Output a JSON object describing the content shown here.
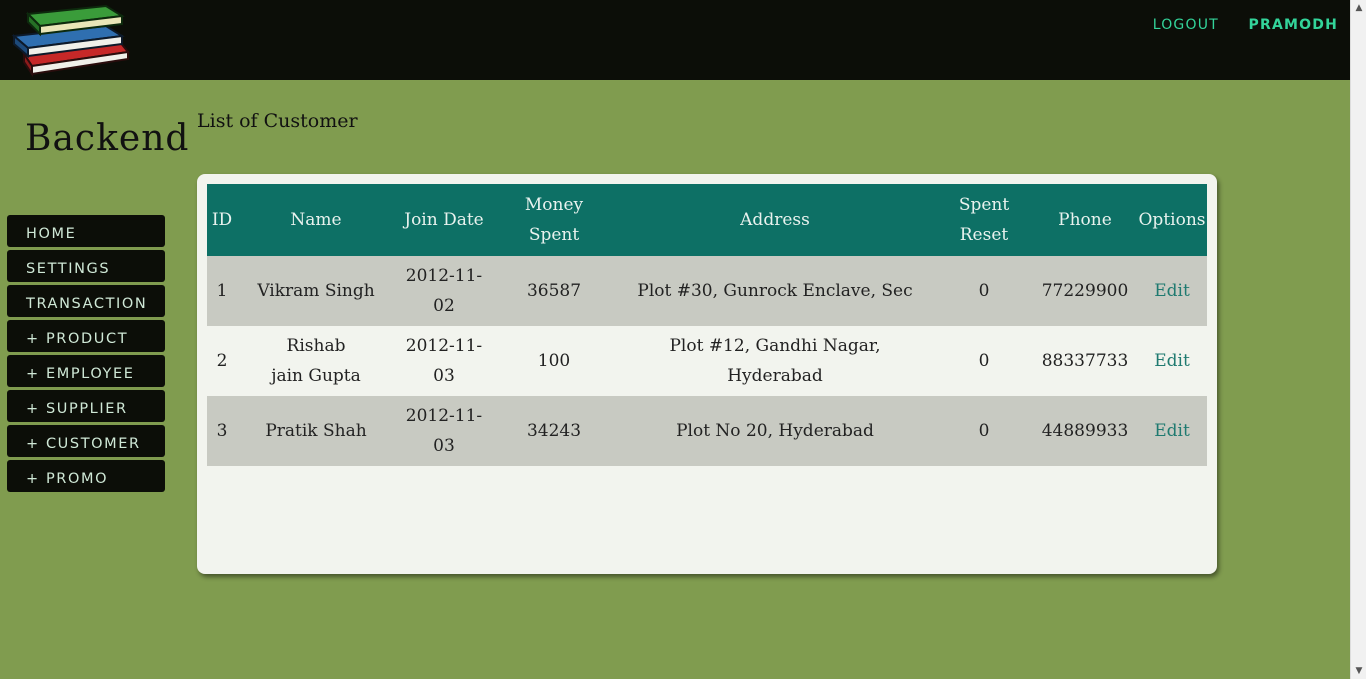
{
  "header": {
    "logout_label": "LOGOUT",
    "username": "PRAMODH"
  },
  "brand": "Backend",
  "page_title": "List of Customer",
  "sidebar": {
    "items": [
      {
        "label": "HOME"
      },
      {
        "label": "SETTINGS"
      },
      {
        "label": "TRANSACTION"
      },
      {
        "label": "+ PRODUCT"
      },
      {
        "label": "+ EMPLOYEE"
      },
      {
        "label": "+ SUPPLIER"
      },
      {
        "label": "+ CUSTOMER"
      },
      {
        "label": "+ PROMO"
      }
    ]
  },
  "table": {
    "columns": {
      "id": "ID",
      "name": "Name",
      "join_date": "Join Date",
      "money_spent_line1": "Money",
      "money_spent_line2": "Spent",
      "address": "Address",
      "spent_reset_line1": "Spent",
      "spent_reset_line2": "Reset",
      "phone": "Phone",
      "options": "Options"
    },
    "rows": [
      {
        "id": "1",
        "name_line1": "Vikram Singh",
        "name_line2": "",
        "join_date": "2012-11-02",
        "money_spent": "36587",
        "address_line1": "Plot #30, Gunrock Enclave, Sec",
        "address_line2": "",
        "spent_reset": "0",
        "phone": "77229900",
        "option": "Edit"
      },
      {
        "id": "2",
        "name_line1": "Rishab",
        "name_line2": "jain Gupta",
        "join_date": "2012-11-03",
        "money_spent": "100",
        "address_line1": "Plot #12, Gandhi Nagar,",
        "address_line2": "Hyderabad",
        "spent_reset": "0",
        "phone": "88337733",
        "option": "Edit"
      },
      {
        "id": "3",
        "name_line1": "Pratik Shah",
        "name_line2": "",
        "join_date": "2012-11-03",
        "money_spent": "34243",
        "address_line1": "Plot No 20, Hyderabad",
        "address_line2": "",
        "spent_reset": "0",
        "phone": "44889933",
        "option": "Edit"
      }
    ]
  },
  "colors": {
    "background": "#809c4f",
    "topbar": "#0c0e08",
    "table_header": "#0d7065",
    "accent_link": "#33d49a"
  },
  "icons": {
    "logo": "stacked-books-icon"
  }
}
